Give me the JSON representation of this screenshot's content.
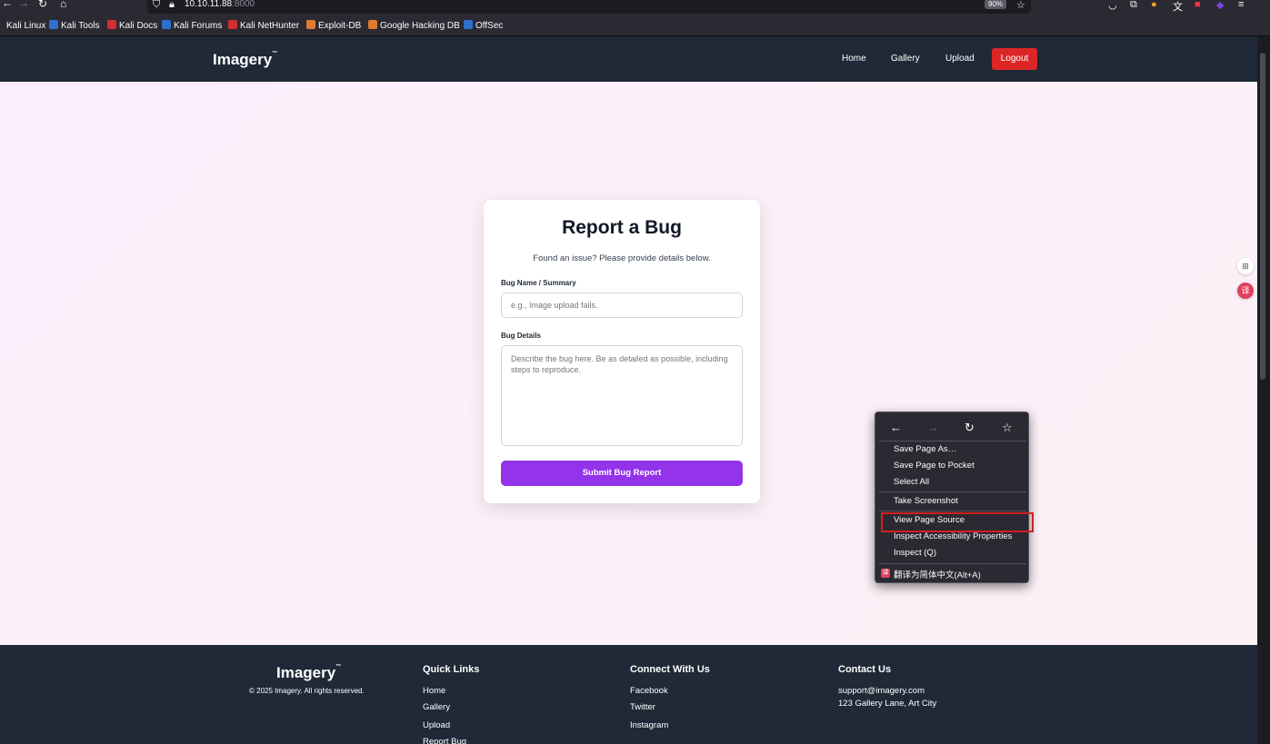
{
  "browser": {
    "url_host": "10.10.11.88",
    "url_port": ":8000",
    "zoom": "90%",
    "bookmarks": [
      {
        "label": "Kali Linux",
        "color": "#2f6fd0"
      },
      {
        "label": "Kali Tools",
        "color": "#2f6fd0"
      },
      {
        "label": "Kali Docs",
        "color": "#d32f2f"
      },
      {
        "label": "Kali Forums",
        "color": "#2f6fd0"
      },
      {
        "label": "Kali NetHunter",
        "color": "#d32f2f"
      },
      {
        "label": "Exploit-DB",
        "color": "#e07a2f"
      },
      {
        "label": "Google Hacking DB",
        "color": "#e07a2f"
      },
      {
        "label": "OffSec",
        "color": "#2f6fd0"
      }
    ]
  },
  "header": {
    "logo": "Imagery",
    "nav": [
      "Home",
      "Gallery",
      "Upload"
    ],
    "logout": "Logout"
  },
  "form": {
    "title": "Report a Bug",
    "subtitle": "Found an issue? Please provide details below.",
    "name_label": "Bug Name / Summary",
    "name_placeholder": "e.g., Image upload fails.",
    "details_label": "Bug Details",
    "details_placeholder": "Describe the bug here. Be as detailed as possible, including steps to reproduce.",
    "submit": "Submit Bug Report"
  },
  "footer": {
    "logo": "Imagery",
    "copyright": "© 2025 Imagery. All rights reserved.",
    "quick_links_title": "Quick Links",
    "quick_links": [
      "Home",
      "Gallery",
      "Upload",
      "Report Bug"
    ],
    "connect_title": "Connect With Us",
    "connect_links": [
      "Facebook",
      "Twitter",
      "Instagram"
    ],
    "contact_title": "Contact Us",
    "email": "support@imagery.com",
    "address": "123 Gallery Lane, Art City"
  },
  "context_menu": {
    "items": [
      "Save Page As…",
      "Save Page to Pocket",
      "Select All",
      "Take Screenshot",
      "View Page Source",
      "Inspect Accessibility Properties",
      "Inspect (Q)",
      "翻译为简体中文(Alt+A)"
    ],
    "highlight_color": "#d21f1f"
  },
  "colors": {
    "header_bg": "#1f2937",
    "logout_bg": "#dc2626",
    "submit_bg": "#9333ea"
  }
}
